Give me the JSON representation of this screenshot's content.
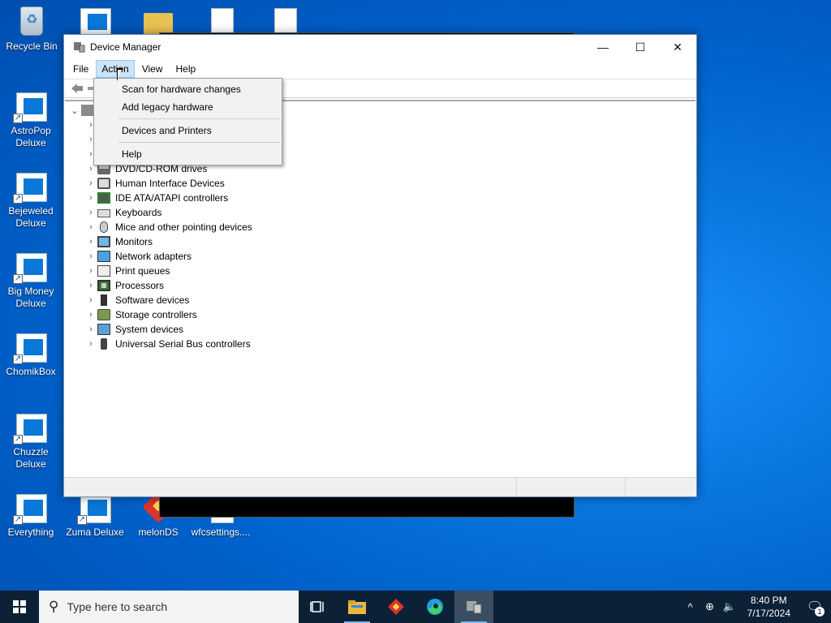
{
  "desktop": {
    "icons": [
      {
        "label": "Recycle Bin"
      },
      {
        "label": "AstroPop Deluxe"
      },
      {
        "label": "Bejeweled Deluxe"
      },
      {
        "label": "Big Money Deluxe"
      },
      {
        "label": "ChomikBox"
      },
      {
        "label": "Chuzzle Deluxe"
      },
      {
        "label": "Everything"
      },
      {
        "label": "Zuma Deluxe"
      },
      {
        "label": "melonDS"
      },
      {
        "label": "wfcsettings...."
      }
    ]
  },
  "window": {
    "title": "Device Manager",
    "controls": {
      "minimize": "—",
      "maximize": "☐",
      "close": "✕"
    },
    "menus": [
      "File",
      "Action",
      "View",
      "Help"
    ],
    "active_menu": "Action"
  },
  "tree": {
    "items": [
      {
        "label": "DVD/CD-ROM drives",
        "icon": "disk-drive-icon"
      },
      {
        "label": "Human Interface Devices",
        "icon": "hid-icon"
      },
      {
        "label": "IDE ATA/ATAPI controllers",
        "icon": "ide-controller-icon"
      },
      {
        "label": "Keyboards",
        "icon": "keyboard-icon"
      },
      {
        "label": "Mice and other pointing devices",
        "icon": "mouse-icon"
      },
      {
        "label": "Monitors",
        "icon": "monitor-icon"
      },
      {
        "label": "Network adapters",
        "icon": "network-adapter-icon"
      },
      {
        "label": "Print queues",
        "icon": "printer-icon"
      },
      {
        "label": "Processors",
        "icon": "processor-icon"
      },
      {
        "label": "Software devices",
        "icon": "software-device-icon"
      },
      {
        "label": "Storage controllers",
        "icon": "storage-controller-icon"
      },
      {
        "label": "System devices",
        "icon": "system-devices-icon"
      },
      {
        "label": "Universal Serial Bus controllers",
        "icon": "usb-icon"
      }
    ]
  },
  "action_menu": {
    "items": [
      "Scan for hardware changes",
      "Add legacy hardware",
      "Devices and Printers",
      "Help"
    ]
  },
  "taskbar": {
    "search_placeholder": "Type here to search",
    "time": "8:40 PM",
    "date": "7/17/2024",
    "notification_count": "1"
  }
}
